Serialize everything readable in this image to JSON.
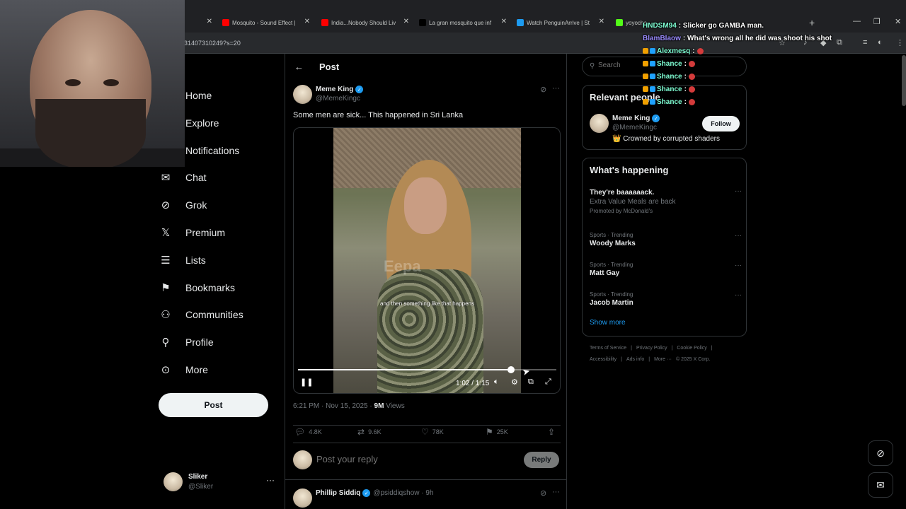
{
  "browser": {
    "tabs": [
      {
        "label": "Mosquito - Sound Effect |",
        "color": "#ff0000"
      },
      {
        "label": "India...Nobody Should Liv",
        "color": "#ff0000"
      },
      {
        "label": "La gran mosquito que inf",
        "color": "#000000"
      },
      {
        "label": "Watch PenguinArrive | St",
        "color": "#1d9bf0"
      },
      {
        "label": "yoyoche",
        "color": "#53fc18"
      }
    ],
    "url": "31407310249?s=20"
  },
  "chat": [
    {
      "user": "HNDSM94",
      "color": "#7fffd4",
      "text": ": Slicker go GAMBA man."
    },
    {
      "user": "BlamBlaow",
      "color": "#9b8cff",
      "text": ": What's wrong all he did was shoot his shot"
    },
    {
      "user": "Alexmesq",
      "color": "#7fffd4",
      "text": ":"
    },
    {
      "user": "Shance",
      "color": "#7fffd4",
      "text": ":"
    },
    {
      "user": "Shance",
      "color": "#7fffd4",
      "text": ":"
    },
    {
      "user": "Shance",
      "color": "#7fffd4",
      "text": ":"
    },
    {
      "user": "Shance",
      "color": "#7fffd4",
      "text": ":"
    }
  ],
  "nav": {
    "items": [
      {
        "label": "Home",
        "icon": "home-icon",
        "glyph": ""
      },
      {
        "label": "Explore",
        "icon": "explore-icon",
        "glyph": ""
      },
      {
        "label": "Notifications",
        "icon": "bell-icon",
        "glyph": ""
      },
      {
        "label": "Chat",
        "icon": "mail-icon",
        "glyph": "✉"
      },
      {
        "label": "Grok",
        "icon": "grok-icon",
        "glyph": "⊘"
      },
      {
        "label": "Premium",
        "icon": "x-logo-icon",
        "glyph": "𝕏"
      },
      {
        "label": "Lists",
        "icon": "list-icon",
        "glyph": "☰"
      },
      {
        "label": "Bookmarks",
        "icon": "bookmark-icon",
        "glyph": "⚑"
      },
      {
        "label": "Communities",
        "icon": "communities-icon",
        "glyph": "⚇"
      },
      {
        "label": "Profile",
        "icon": "person-icon",
        "glyph": "⚲"
      },
      {
        "label": "More",
        "icon": "more-circle-icon",
        "glyph": "⊙"
      }
    ],
    "post_label": "Post"
  },
  "me": {
    "name": "Sliker",
    "handle": "@Sliker"
  },
  "main": {
    "title": "Post",
    "author": {
      "name": "Meme King",
      "handle": "@MemeKingc"
    },
    "text": "Some men are sick... This happened in Sri Lanka",
    "video": {
      "watermark": "Eepa",
      "subtitle": "and then something like that happens",
      "time": "1:02 / 1:15",
      "progress": 0.826
    },
    "meta": {
      "time": "6:21 PM · Nov 15, 2025 · ",
      "views": "9M",
      "views_label": " Views"
    },
    "stats": {
      "replies": "4.8K",
      "reposts": "9.6K",
      "likes": "78K",
      "bookmarks": "25K"
    },
    "reply": {
      "placeholder": "Post your reply",
      "button": "Reply"
    },
    "next_reply": {
      "name": "Phillip Siddiq",
      "handle": "@psiddiqshow · 9h"
    }
  },
  "sidebar": {
    "search_placeholder": "Search",
    "relevant": {
      "title": "Relevant people",
      "name": "Meme King",
      "handle": "@MemeKingc",
      "bio": "👑 Crowned by corrupted shaders",
      "follow": "Follow"
    },
    "happening": {
      "title": "What's happening",
      "trends": [
        {
          "context": "",
          "title": "They're baaaaaack.",
          "sub": "Extra Value Meals are back",
          "promo": "Promoted by McDonald's"
        },
        {
          "context": "Sports · Trending",
          "title": "Woody Marks",
          "sub": "",
          "promo": ""
        },
        {
          "context": "Sports · Trending",
          "title": "Matt Gay",
          "sub": "",
          "promo": ""
        },
        {
          "context": "Sports · Trending",
          "title": "Jacob Martin",
          "sub": "",
          "promo": ""
        }
      ],
      "show_more": "Show more"
    },
    "footer": {
      "row1": [
        "Terms of Service",
        "|",
        "Privacy Policy",
        "|",
        "Cookie Policy",
        "|"
      ],
      "row2": [
        "Accessibility",
        "|",
        "Ads info",
        "|",
        "More ···",
        "© 2025 X Corp."
      ]
    }
  }
}
